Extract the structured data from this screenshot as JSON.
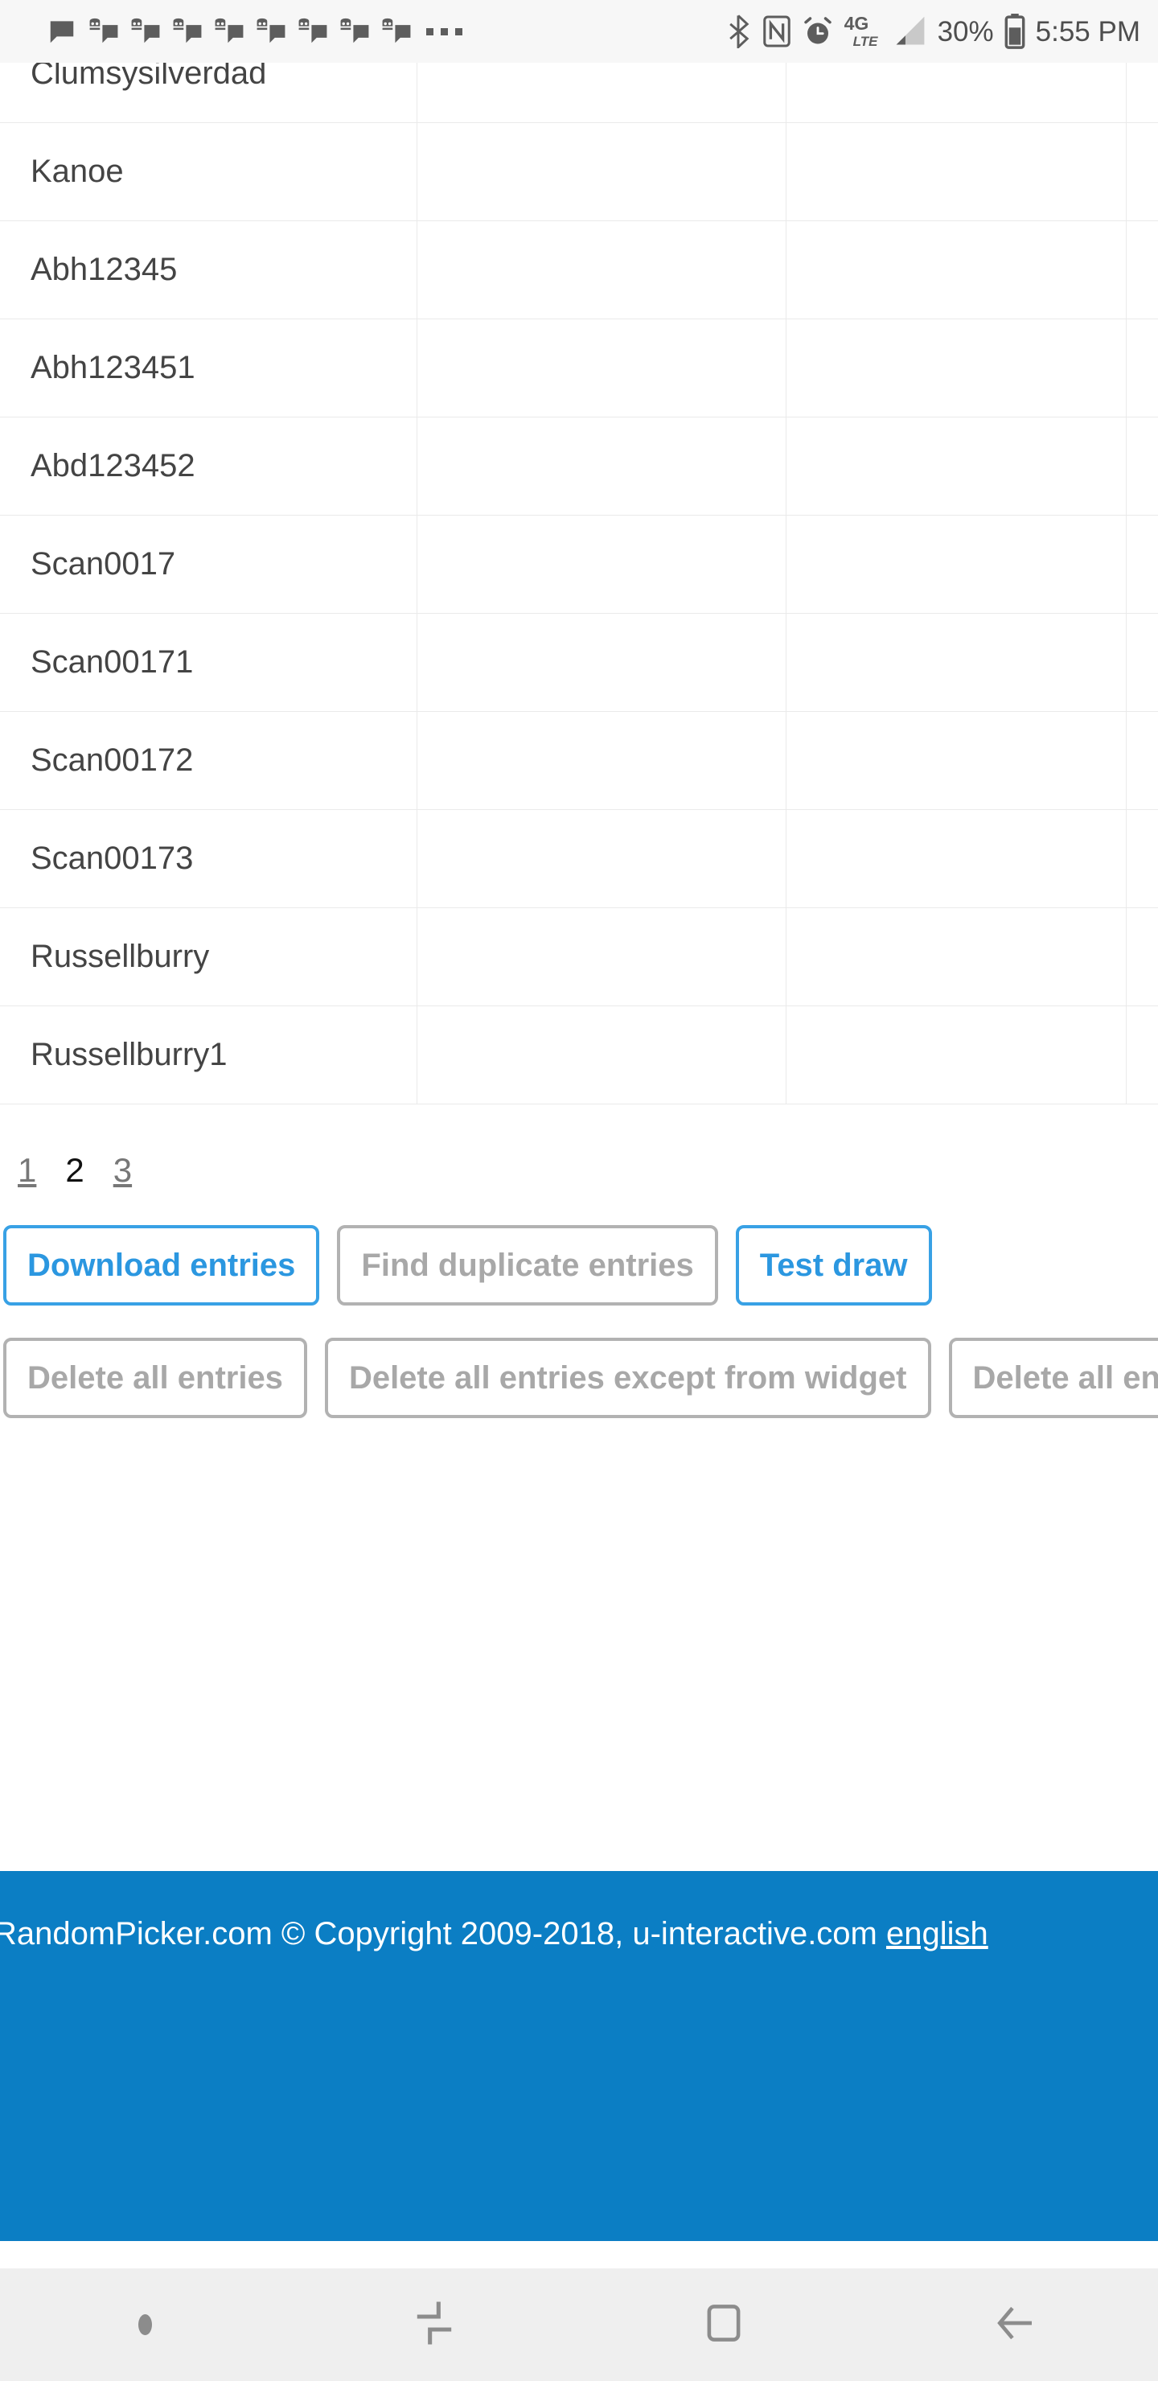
{
  "status_bar": {
    "icons_left": [
      "message-icon",
      "message-group-icon",
      "message-group-icon",
      "message-group-icon",
      "message-group-icon",
      "message-group-icon",
      "message-group-icon",
      "message-group-icon",
      "message-group-icon",
      "more-dots-icon"
    ],
    "icons_right": [
      "bluetooth-icon",
      "nfc-icon",
      "alarm-icon",
      "network-4g-lte-icon",
      "signal-bars-icon",
      "battery-icon"
    ],
    "network_label_primary": "4G",
    "network_label_secondary": "LTE",
    "battery_percent": "30%",
    "clock": "5:55 PM"
  },
  "table": {
    "columns": [
      "entry-name",
      "column-2",
      "column-3",
      "column-4"
    ],
    "rows": [
      {
        "name": "Clumsysilverdad",
        "c2": "",
        "c3": "",
        "c4": ""
      },
      {
        "name": "Kanoe",
        "c2": "",
        "c3": "",
        "c4": ""
      },
      {
        "name": "Abh12345",
        "c2": "",
        "c3": "",
        "c4": ""
      },
      {
        "name": "Abh123451",
        "c2": "",
        "c3": "",
        "c4": ""
      },
      {
        "name": "Abd123452",
        "c2": "",
        "c3": "",
        "c4": ""
      },
      {
        "name": "Scan0017",
        "c2": "",
        "c3": "",
        "c4": ""
      },
      {
        "name": "Scan00171",
        "c2": "",
        "c3": "",
        "c4": ""
      },
      {
        "name": "Scan00172",
        "c2": "",
        "c3": "",
        "c4": ""
      },
      {
        "name": "Scan00173",
        "c2": "",
        "c3": "",
        "c4": ""
      },
      {
        "name": "Russellburry",
        "c2": "",
        "c3": "",
        "c4": ""
      },
      {
        "name": "Russellburry1",
        "c2": "",
        "c3": "",
        "c4": ""
      }
    ]
  },
  "pagination": {
    "pages": [
      "1",
      "2",
      "3"
    ],
    "current": "2"
  },
  "actions": {
    "row1": [
      {
        "label": "Download entries",
        "state": "enabled"
      },
      {
        "label": "Find duplicate entries",
        "state": "disabled"
      },
      {
        "label": "Test draw",
        "state": "enabled"
      }
    ],
    "row2": [
      {
        "label": "Delete all entries",
        "state": "disabled"
      },
      {
        "label": "Delete all entries except from widget",
        "state": "disabled"
      },
      {
        "label": "Delete all entries from widget",
        "state": "disabled"
      }
    ]
  },
  "footer": {
    "text": "RandomPicker.com © Copyright 2009-2018, u-interactive.com ",
    "language_link": "english"
  },
  "nav_bar": {
    "items": [
      "dot-indicator",
      "recents-icon",
      "home-icon",
      "back-icon"
    ]
  },
  "colors": {
    "accent_blue": "#38a1e5",
    "footer_blue": "#0b7ec4",
    "disabled_gray": "#b2b2b2",
    "status_bar_bg": "#f7f7f7",
    "nav_bar_bg": "#efefef"
  }
}
